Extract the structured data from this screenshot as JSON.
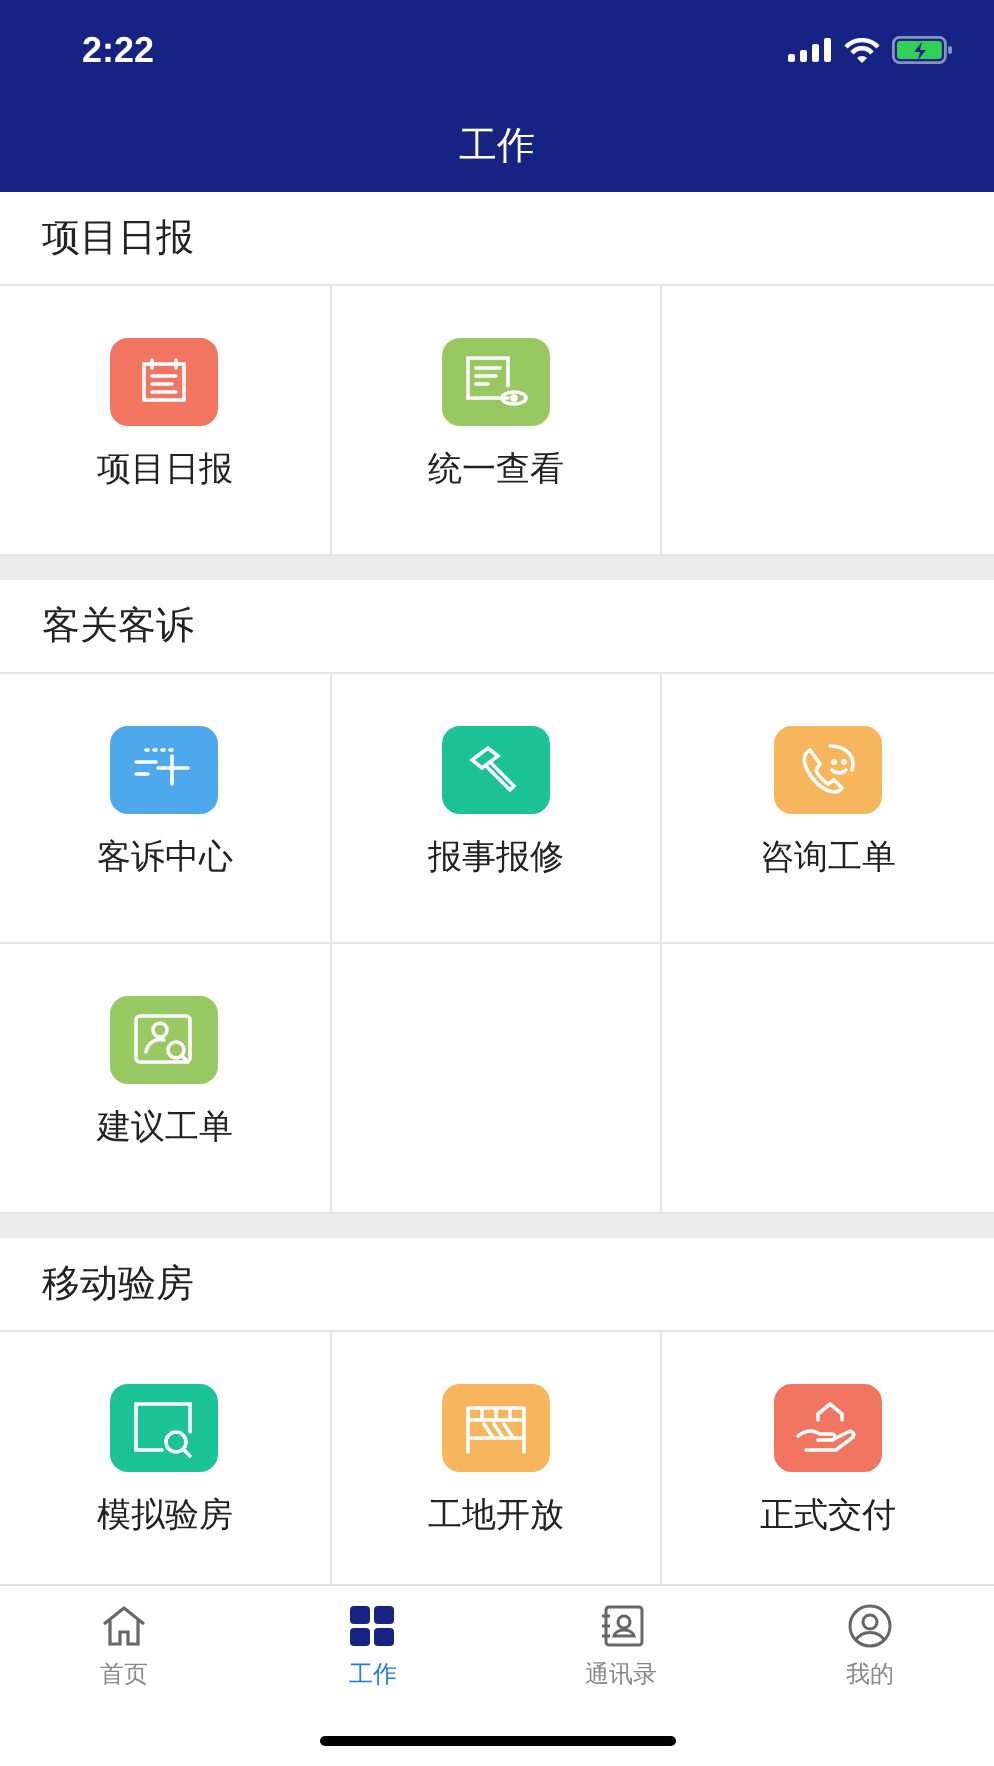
{
  "status_bar": {
    "time": "2:22"
  },
  "nav": {
    "title": "工作"
  },
  "sections": [
    {
      "title": "项目日报",
      "items": [
        {
          "label": "项目日报",
          "kind": "notepad",
          "color": "#f27562"
        },
        {
          "label": "统一查看",
          "kind": "document",
          "color": "#98c862"
        }
      ]
    },
    {
      "title": "客关客诉",
      "items": [
        {
          "label": "客诉中心",
          "kind": "addlist",
          "color": "#4da9ec"
        },
        {
          "label": "报事报修",
          "kind": "hammer",
          "color": "#1ac296"
        },
        {
          "label": "咨询工单",
          "kind": "phone",
          "color": "#f7b55d"
        },
        {
          "label": "建议工单",
          "kind": "person",
          "color": "#98c862"
        }
      ]
    },
    {
      "title": "移动验房",
      "items": [
        {
          "label": "模拟验房",
          "kind": "magnifier",
          "color": "#1ac296"
        },
        {
          "label": "工地开放",
          "kind": "barrier",
          "color": "#f7b55d"
        },
        {
          "label": "正式交付",
          "kind": "hand",
          "color": "#f27562"
        }
      ]
    }
  ],
  "tab_bar": [
    {
      "label": "首页",
      "kind": "home",
      "selected": false
    },
    {
      "label": "工作",
      "kind": "grid",
      "selected": true
    },
    {
      "label": "通讯录",
      "kind": "contacts",
      "selected": false
    },
    {
      "label": "我的",
      "kind": "profile",
      "selected": false
    }
  ]
}
